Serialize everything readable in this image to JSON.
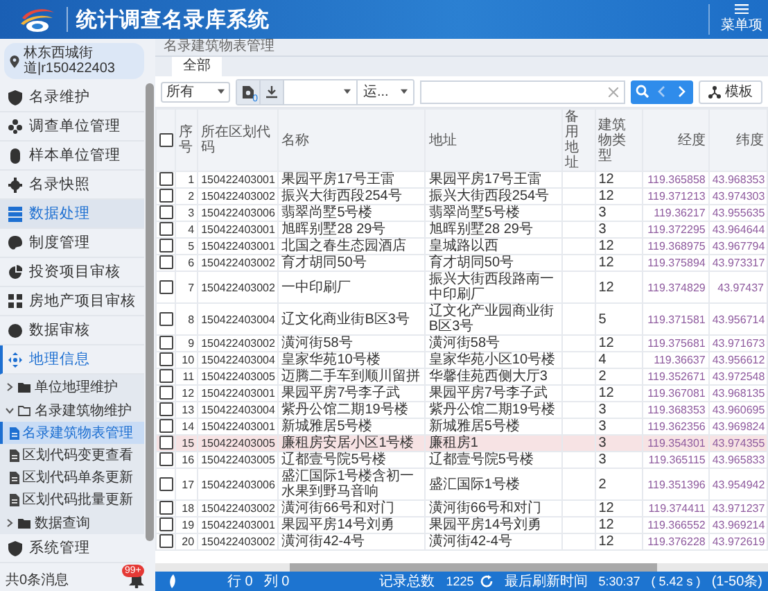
{
  "header": {
    "title": "统计调查名录库系统",
    "menu_label": "菜单项"
  },
  "sidebar": {
    "location": "林东西城街道|r150422403",
    "items": [
      {
        "label": "名录维护",
        "selected": false
      },
      {
        "label": "调查单位管理",
        "selected": false
      },
      {
        "label": "样本单位管理",
        "selected": false
      },
      {
        "label": "名录快照",
        "selected": false
      },
      {
        "label": "数据处理",
        "selected": true
      },
      {
        "label": "制度管理",
        "selected": false
      },
      {
        "label": "投资项目审核",
        "selected": false
      },
      {
        "label": "房地产项目审核",
        "selected": false
      },
      {
        "label": "数据审核",
        "selected": false
      },
      {
        "label": "地理信息",
        "selected": false,
        "expanded": true,
        "children": [
          {
            "label": "单位地理维护",
            "selected": false,
            "expanded": false
          },
          {
            "label": "名录建筑物维护",
            "selected": false,
            "expanded": true,
            "children": [
              {
                "label": "名录建筑物表管理",
                "selected": true
              },
              {
                "label": "区划代码变更查看",
                "selected": false
              },
              {
                "label": "区划代码单条更新",
                "selected": false
              },
              {
                "label": "区划代码批量更新",
                "selected": false
              }
            ]
          },
          {
            "label": "数据查询",
            "selected": false,
            "expanded": false
          }
        ]
      },
      {
        "label": "系统管理",
        "selected": false
      }
    ],
    "footer": {
      "message": "共0条消息",
      "badge": "99+"
    }
  },
  "breadcrumb": "名录建筑物表管理",
  "tabs": [
    {
      "label": "全部",
      "selected": true
    }
  ],
  "toolbar": {
    "scope_select": "所有",
    "doc_count": "0",
    "filter_select": "运...",
    "template_button": "模板"
  },
  "table": {
    "select_all_checked": false,
    "columns": [
      "序号",
      "所在区划代码",
      "名称",
      "地址",
      "备用地址",
      "建筑物类型",
      "经度",
      "纬度"
    ],
    "rows": [
      {
        "checked": false,
        "selected": false,
        "no": "1",
        "code": "150422403001",
        "name": "果园平房17号王雷",
        "address": "果园平房17号王雷",
        "type": "12",
        "lon": "119.365858",
        "lat": "43.968353"
      },
      {
        "checked": false,
        "selected": false,
        "no": "2",
        "code": "150422403002",
        "name": "振兴大街西段254号",
        "address": "振兴大街西段254号",
        "type": "12",
        "lon": "119.371213",
        "lat": "43.974303"
      },
      {
        "checked": false,
        "selected": false,
        "no": "3",
        "code": "150422403006",
        "name": "翡翠尚墅5号楼",
        "address": "翡翠尚墅5号楼",
        "type": "3",
        "lon": "119.36217",
        "lat": "43.955635"
      },
      {
        "checked": false,
        "selected": false,
        "no": "4",
        "code": "150422403001",
        "name": "旭晖别墅28 29号",
        "address": "旭晖别墅28 29号",
        "type": "3",
        "lon": "119.372295",
        "lat": "43.964644"
      },
      {
        "checked": false,
        "selected": false,
        "no": "5",
        "code": "150422403001",
        "name": "北国之春生态园酒店",
        "address": "皇城路以西",
        "type": "12",
        "lon": "119.368975",
        "lat": "43.967794"
      },
      {
        "checked": false,
        "selected": false,
        "no": "6",
        "code": "150422403002",
        "name": "育才胡同50号",
        "address": "育才胡同50号",
        "type": "12",
        "lon": "119.375894",
        "lat": "43.973317"
      },
      {
        "checked": false,
        "selected": false,
        "no": "7",
        "code": "150422403002",
        "name": "一中印刷厂",
        "address": "振兴大街西段路南一中印刷厂",
        "type": "12",
        "lon": "119.374829",
        "lat": "43.97437"
      },
      {
        "checked": false,
        "selected": false,
        "no": "8",
        "code": "150422403004",
        "name": "辽文化商业街B区3号",
        "address": "辽文化产业园商业街B区3号",
        "type": "5",
        "lon": "119.371581",
        "lat": "43.956714"
      },
      {
        "checked": false,
        "selected": false,
        "no": "9",
        "code": "150422403002",
        "name": "潢河街58号",
        "address": "潢河街58号",
        "type": "12",
        "lon": "119.375681",
        "lat": "43.971673"
      },
      {
        "checked": false,
        "selected": false,
        "no": "10",
        "code": "150422403004",
        "name": "皇家华苑10号楼",
        "address": "皇家华苑小区10号楼",
        "type": "4",
        "lon": "119.36637",
        "lat": "43.956612"
      },
      {
        "checked": false,
        "selected": false,
        "no": "11",
        "code": "150422403005",
        "name": "迈腾二手车到顺川留拼",
        "address": "华馨佳苑西侧大厅3",
        "type": "2",
        "lon": "119.352671",
        "lat": "43.972548"
      },
      {
        "checked": false,
        "selected": false,
        "no": "12",
        "code": "150422403001",
        "name": "果园平房7号李子武",
        "address": "果园平房7号李子武",
        "type": "12",
        "lon": "119.367081",
        "lat": "43.968135"
      },
      {
        "checked": false,
        "selected": false,
        "no": "13",
        "code": "150422403004",
        "name": "紫丹公馆二期19号楼",
        "address": "紫丹公馆二期19号楼",
        "type": "3",
        "lon": "119.368353",
        "lat": "43.960695"
      },
      {
        "checked": false,
        "selected": false,
        "no": "14",
        "code": "150422403001",
        "name": "新城雅居5号楼",
        "address": "新城雅居5号楼",
        "type": "3",
        "lon": "119.362356",
        "lat": "43.969824"
      },
      {
        "checked": false,
        "selected": true,
        "no": "15",
        "code": "150422403005",
        "name": "廉租房安居小区1号楼",
        "address": "廉租房1",
        "type": "3",
        "lon": "119.354301",
        "lat": "43.974355"
      },
      {
        "checked": false,
        "selected": false,
        "no": "16",
        "code": "150422403005",
        "name": "辽都壹号院5号楼",
        "address": "辽都壹号院5号楼",
        "type": "3",
        "lon": "119.365115",
        "lat": "43.965833"
      },
      {
        "checked": false,
        "selected": false,
        "no": "17",
        "code": "150422403006",
        "name": "盛汇国际1号楼含初一水果到野马音响",
        "address": "盛汇国际1号楼",
        "type": "2",
        "lon": "119.351396",
        "lat": "43.954942"
      },
      {
        "checked": false,
        "selected": false,
        "no": "18",
        "code": "150422403002",
        "name": "潢河街66号和对门",
        "address": "潢河街66号和对门",
        "type": "12",
        "lon": "119.374411",
        "lat": "43.971237"
      },
      {
        "checked": false,
        "selected": false,
        "no": "19",
        "code": "150422403001",
        "name": "果园平房14号刘勇",
        "address": "果园平房14号刘勇",
        "type": "12",
        "lon": "119.366552",
        "lat": "43.969214"
      },
      {
        "checked": false,
        "selected": false,
        "no": "20",
        "code": "150422403002",
        "name": "潢河街42-4号",
        "address": "潢河街42-4号",
        "type": "12",
        "lon": "119.376228",
        "lat": "43.972619"
      }
    ]
  },
  "status_bar": {
    "row": "行 0",
    "col": "列 0",
    "total_label": "记录总数",
    "total": "1225",
    "refresh_label": "最后刷新时间",
    "refresh_time": "5:30:37",
    "duration": "( 5.42 s )",
    "range": "(1-50条)"
  }
}
